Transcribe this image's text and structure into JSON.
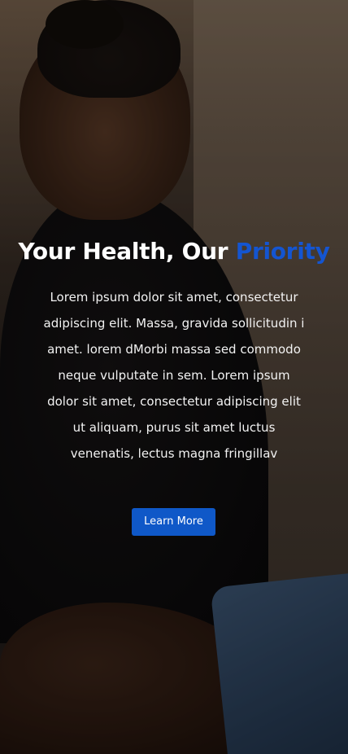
{
  "hero": {
    "title_prefix": "Your Health, Our ",
    "title_accent": "Priority",
    "body": "Lorem ipsum dolor sit amet, consectetur adipiscing elit. Massa, gravida sollicitudin i amet. lorem dMorbi massa sed commodo neque vulputate in sem. Lorem ipsum dolor sit amet, consectetur adipiscing elit ut aliquam, purus sit amet luctus venenatis, lectus magna fringillav",
    "cta_label": "Learn More"
  },
  "colors": {
    "accent": "#1455d1",
    "button": "#0f58c8",
    "text": "#ffffff"
  }
}
